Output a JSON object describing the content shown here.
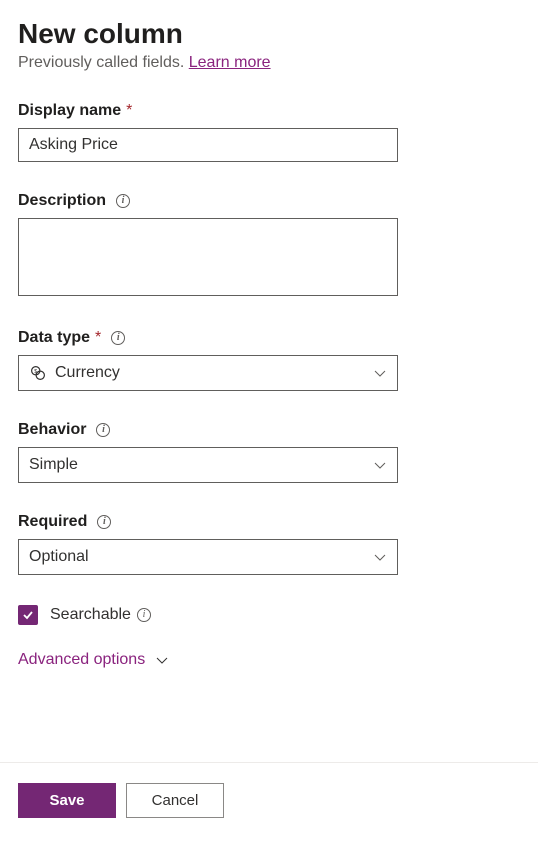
{
  "header": {
    "title": "New column",
    "subtitle_prefix": "Previously called fields. ",
    "learn_more": "Learn more"
  },
  "fields": {
    "display_name": {
      "label": "Display name",
      "value": "Asking Price"
    },
    "description": {
      "label": "Description",
      "value": ""
    },
    "data_type": {
      "label": "Data type",
      "value": "Currency",
      "icon": "currency-icon"
    },
    "behavior": {
      "label": "Behavior",
      "value": "Simple"
    },
    "required": {
      "label": "Required",
      "value": "Optional"
    },
    "searchable": {
      "label": "Searchable",
      "checked": true
    },
    "advanced": {
      "label": "Advanced options"
    }
  },
  "footer": {
    "save": "Save",
    "cancel": "Cancel"
  },
  "colors": {
    "accent": "#742774",
    "required": "#a4262c"
  }
}
